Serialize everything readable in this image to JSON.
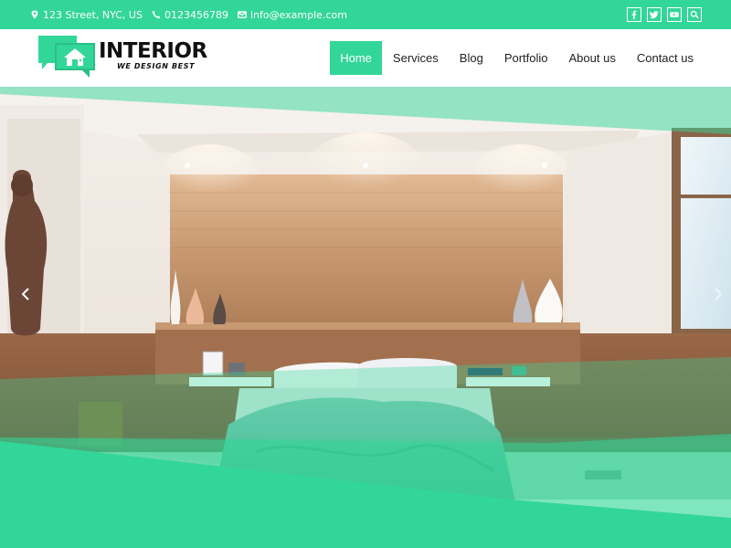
{
  "topbar": {
    "address": "123 Street, NYC, US",
    "phone": "0123456789",
    "email": "info@example.com",
    "address_icon": "map-marker-icon",
    "phone_icon": "phone-icon",
    "email_icon": "envelope-icon",
    "socials": [
      "facebook-icon",
      "twitter-icon",
      "youtube-icon",
      "search-icon"
    ]
  },
  "brand": {
    "title": "INTERIOR",
    "tagline": "WE DESIGN BEST",
    "icon": "house-chat-logo-icon"
  },
  "nav": {
    "items": [
      "Home",
      "Services",
      "Blog",
      "Portfolio",
      "About us",
      "Contact us"
    ],
    "active": "Home"
  },
  "slider": {
    "prev_icon": "chevron-left-icon",
    "next_icon": "chevron-right-icon"
  },
  "colors": {
    "accent": "#33d699",
    "text": "#222222",
    "white": "#ffffff"
  }
}
